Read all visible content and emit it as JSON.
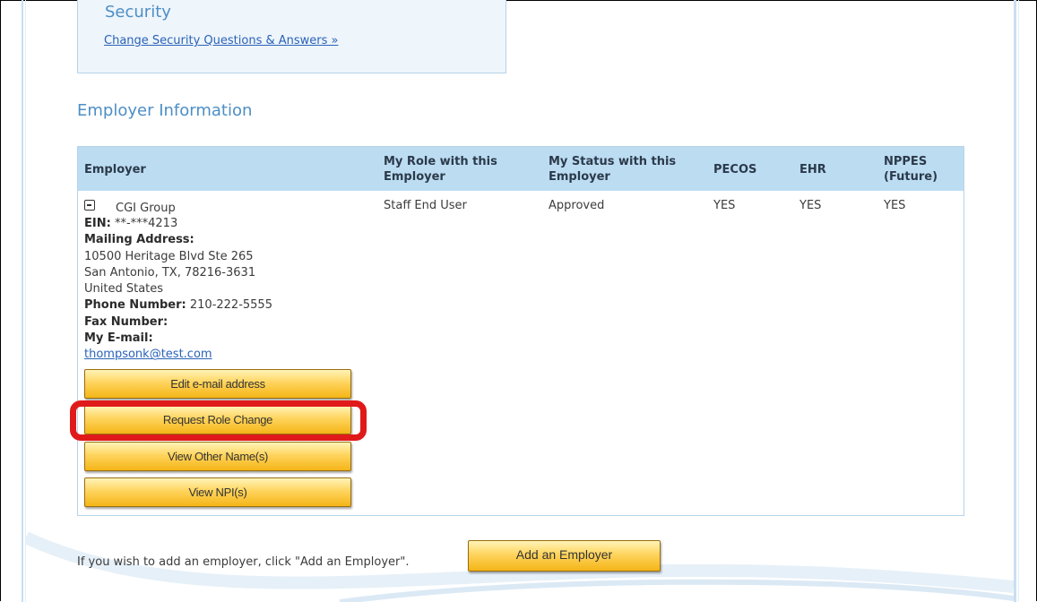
{
  "security": {
    "title": "Security",
    "link": "Change Security Questions & Answers »"
  },
  "employer_section": {
    "title": "Employer Information",
    "columns": [
      "Employer",
      "My Role with this Employer",
      "My Status with this Employer",
      "PECOS",
      "EHR",
      "NPPES (Future)"
    ],
    "row": {
      "employer_name": "CGI Group",
      "role": "Staff End User",
      "status": "Approved",
      "pecos": "YES",
      "ehr": "YES",
      "nppes": "YES",
      "ein_label": "EIN:",
      "ein_value": "**-***4213",
      "mailing_label": "Mailing Address:",
      "address_line1": "10500 Heritage Blvd Ste 265",
      "address_line2": "San Antonio, TX, 78216-3631",
      "address_line3": "United States",
      "phone_label": "Phone Number:",
      "phone_value": "210-222-5555",
      "fax_label": "Fax Number:",
      "email_label": "My E-mail:",
      "email_value": "thompsonk@test.com"
    },
    "buttons": {
      "edit_email": "Edit e-mail address",
      "request_role_change": "Request Role Change",
      "view_other_names": "View Other Name(s)",
      "view_npis": "View NPI(s)"
    }
  },
  "footer": {
    "text": "If you wish to add an employer, click \"Add an Employer\".",
    "add_button": "Add an Employer"
  },
  "colors": {
    "header_bg": "#bcdcf2",
    "title_blue": "#4d8ec6",
    "link_blue": "#2a62b8",
    "button_gold": "#ffd45e",
    "highlight_red": "#e01a1a"
  }
}
